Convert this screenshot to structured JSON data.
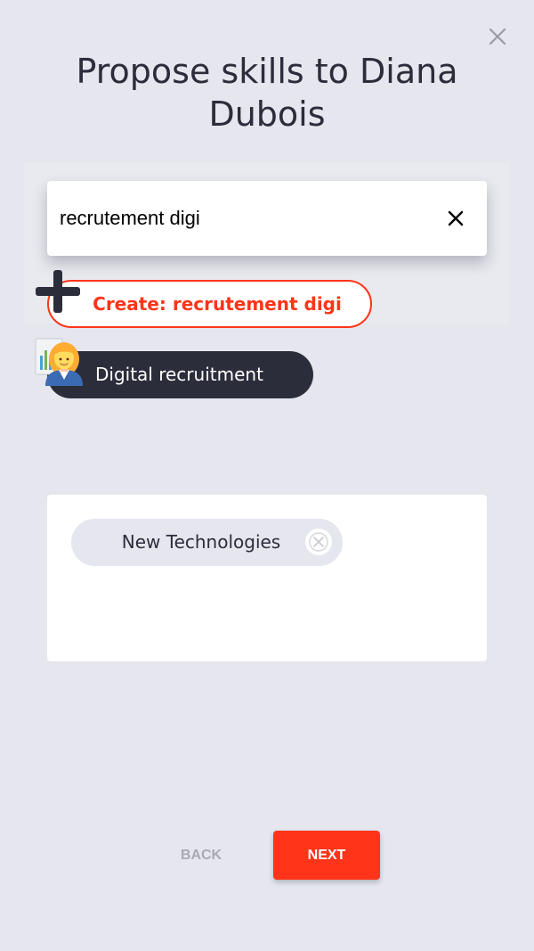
{
  "dialog": {
    "title": "Propose skills to Diana Dubois"
  },
  "search": {
    "value": "recrutement digi",
    "placeholder": ""
  },
  "create_option": {
    "label": "Create: recrutement digi"
  },
  "suggestions": [
    {
      "label": "Digital recruitment",
      "icon": "woman-office-worker-icon"
    }
  ],
  "selected_skills": [
    {
      "label": "New Technologies"
    }
  ],
  "footer": {
    "back_label": "BACK",
    "next_label": "NEXT"
  },
  "colors": {
    "background": "#e5e6ee",
    "accent": "#ff3418",
    "dark": "#2b2d3b",
    "muted": "#a9aab3"
  },
  "icons": {
    "close": "close-icon",
    "clear": "clear-search-icon",
    "create": "plus-icon",
    "chip_remove": "remove-circle-icon"
  }
}
